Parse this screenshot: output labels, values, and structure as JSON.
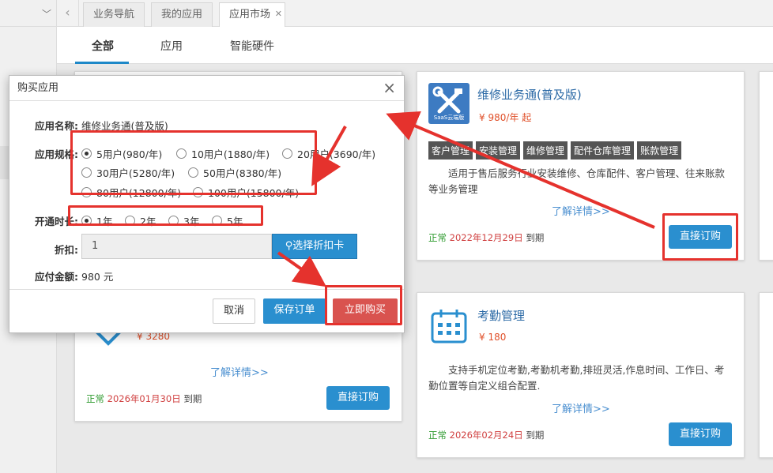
{
  "tabs": {
    "nav": "业务导航",
    "my_apps": "我的应用",
    "market": "应用市场"
  },
  "subtabs": {
    "all": "全部",
    "apps": "应用",
    "hardware": "智能硬件"
  },
  "cards": {
    "repair": {
      "name": "维修业务通(普及版)",
      "price": "¥ 980/年 起",
      "logo_text": "SaaS云端版",
      "tags": [
        "客户管理",
        "安装管理",
        "维修管理",
        "配件仓库管理",
        "账款管理"
      ],
      "desc": "适用于售后服务行业安装维修、仓库配件、客户管理、往来账款等业务管理",
      "more": "了解详情>>",
      "status_ok": "正常",
      "status_date": "2022年12月29日",
      "status_suffix": "到期",
      "buy": "直接订购"
    },
    "left_bottom": {
      "price": "¥ 3280",
      "more": "了解详情>>",
      "status_ok": "正常",
      "status_date": "2026年01月30日",
      "status_suffix": "到期",
      "buy": "直接订购"
    },
    "attendance": {
      "name": "考勤管理",
      "price": "¥ 180",
      "desc": "支持手机定位考勤,考勤机考勤,排班灵活,作息时间、工作日、考勤位置等自定义组合配置.",
      "more": "了解详情>>",
      "status_ok": "正常",
      "status_date": "2026年02月24日",
      "status_suffix": "到期",
      "buy": "直接订购"
    }
  },
  "modal": {
    "title": "购买应用",
    "app_name_label": "应用名称:",
    "app_name": "维修业务通(普及版)",
    "spec_label": "应用规格:",
    "specs": [
      "5用户(980/年)",
      "10用户(1880/年)",
      "20用户(3690/年)",
      "30用户(5280/年)",
      "50用户(8380/年)",
      "80用户(12800/年)",
      "100用户(15800/年)"
    ],
    "duration_label": "开通时长:",
    "durations": [
      "1年",
      "2年",
      "3年",
      "5年"
    ],
    "discount_label": "折扣:",
    "discount_value": "1",
    "discount_btn": "选择折扣卡",
    "amount_label": "应付金额:",
    "amount": "980 元",
    "cancel": "取消",
    "save": "保存订单",
    "buy_now": "立即购买"
  },
  "colors": {
    "primary": "#2a8fcf",
    "danger": "#d9534f",
    "annotation": "#e5322d"
  }
}
